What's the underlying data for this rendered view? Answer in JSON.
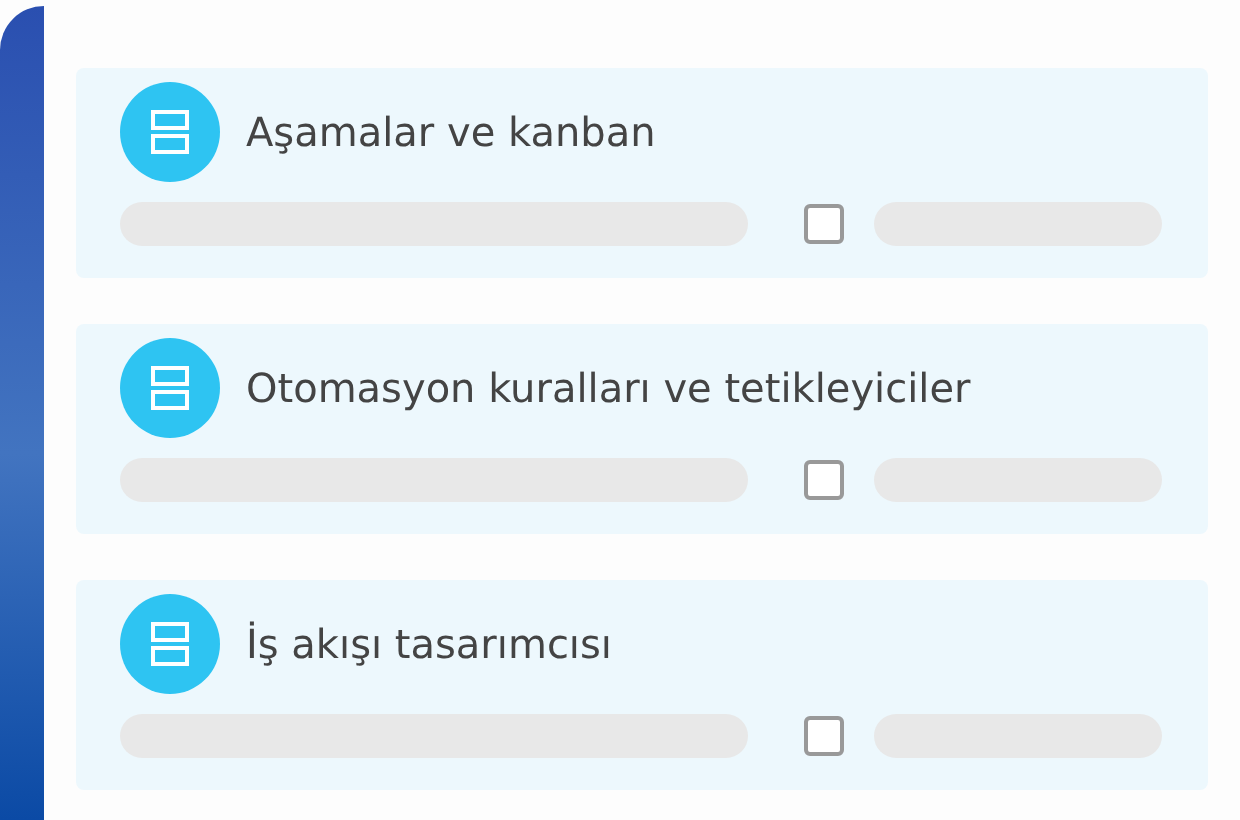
{
  "features": [
    {
      "title": "Aşamalar ve kanban",
      "checked": false
    },
    {
      "title": "Otomasyon kuralları ve tetikleyiciler",
      "checked": false
    },
    {
      "title": "İş akışı tasarımcısı",
      "checked": false
    }
  ]
}
